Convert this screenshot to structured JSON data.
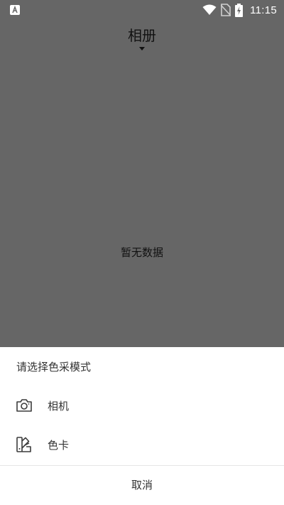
{
  "status_bar": {
    "time": "11:15",
    "icons": [
      "app-notification-icon",
      "wifi-icon",
      "no-sim-icon",
      "battery-charging-icon"
    ]
  },
  "header": {
    "title": "相册"
  },
  "main": {
    "empty_text": "暂无数据"
  },
  "sheet": {
    "title": "请选择色采模式",
    "items": [
      {
        "label": "相机",
        "icon": "camera-icon"
      },
      {
        "label": "色卡",
        "icon": "color-card-icon"
      }
    ],
    "cancel_label": "取消"
  },
  "colors": {
    "background": "#666666",
    "sheet_background": "#ffffff",
    "text_dark": "#333333"
  }
}
